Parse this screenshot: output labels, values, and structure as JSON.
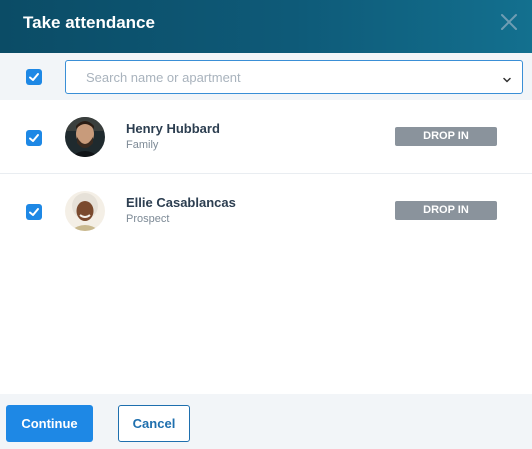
{
  "dialog": {
    "title": "Take attendance",
    "close_icon": "close-icon"
  },
  "search": {
    "select_all_checked": true,
    "placeholder": "Search name or apartment",
    "value": "",
    "dropdown_icon": "chevron-down-icon"
  },
  "attendees": [
    {
      "name": "Henry Hubbard",
      "role": "Family",
      "checked": true,
      "tag": "DROP IN"
    },
    {
      "name": "Ellie Casablancas",
      "role": "Prospect",
      "checked": true,
      "tag": "DROP IN"
    }
  ],
  "footer": {
    "continue_label": "Continue",
    "cancel_label": "Cancel"
  },
  "colors": {
    "header_start": "#0b4c66",
    "header_end": "#13708f",
    "primary": "#1e88e5",
    "tag_bg": "#8a939c"
  }
}
